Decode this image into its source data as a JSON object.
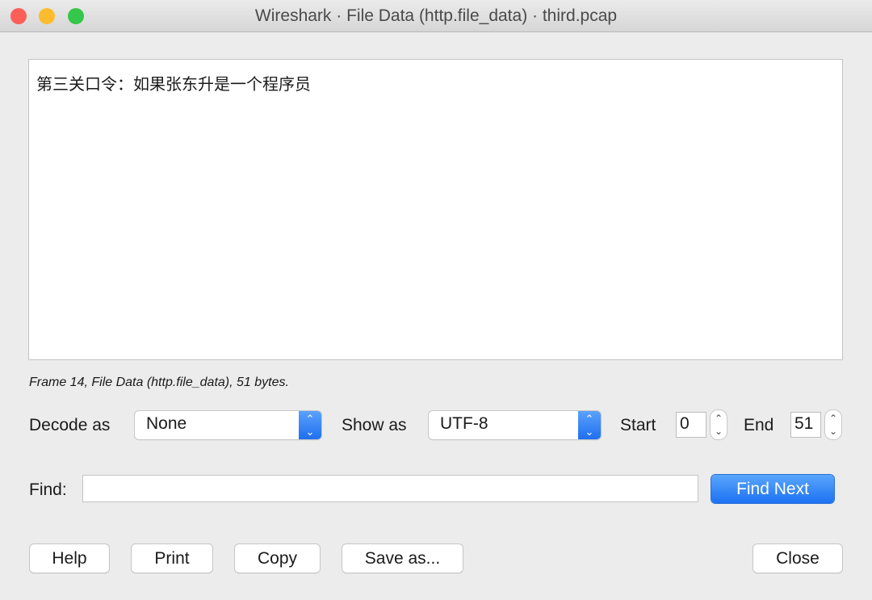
{
  "window": {
    "title": "Wireshark · File Data (http.file_data) · third.pcap"
  },
  "content": {
    "text": "第三关口令：如果张东升是一个程序员"
  },
  "info": "Frame 14, File Data (http.file_data), 51 bytes.",
  "controls": {
    "decode_as_label": "Decode as",
    "decode_as_value": "None",
    "show_as_label": "Show as",
    "show_as_value": "UTF-8",
    "start_label": "Start",
    "start_value": "0",
    "end_label": "End",
    "end_value": "51"
  },
  "find": {
    "label": "Find:",
    "value": "",
    "button": "Find Next"
  },
  "buttons": {
    "help": "Help",
    "print": "Print",
    "copy": "Copy",
    "save_as": "Save as...",
    "close": "Close"
  },
  "colors": {
    "accent": "#1f6ff0",
    "close": "#fc5f57",
    "minimize": "#fdbc2e",
    "zoom": "#28c840"
  }
}
